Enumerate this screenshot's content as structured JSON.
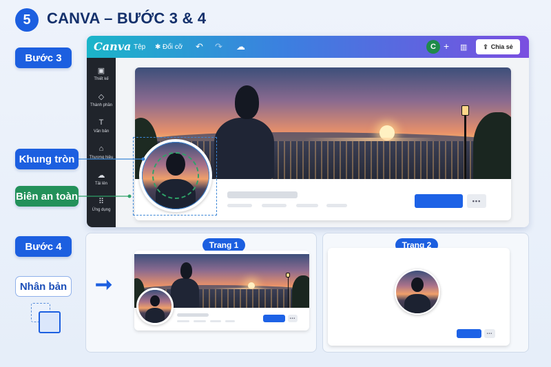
{
  "header": {
    "step_number": "5",
    "title": "CANVA – BƯỚC 3 & 4"
  },
  "labels": {
    "step3": "Bước 3",
    "step4": "Bước 4",
    "circle_frame": "Khung tròn",
    "safe_zone": "Biên an toàn",
    "duplicate": "Nhân bản"
  },
  "canva": {
    "logo": "Canva",
    "menu_file": "Tệp",
    "menu_resize": "Đổi cỡ",
    "avatar_initial": "C",
    "share_label": "Chia sẻ",
    "sidebar": [
      {
        "icon": "layout-icon",
        "label": "Thiết kế"
      },
      {
        "icon": "elements-icon",
        "label": "Thành phần"
      },
      {
        "icon": "text-icon",
        "label": "Văn bản"
      },
      {
        "icon": "brand-icon",
        "label": "Thương hiệu"
      },
      {
        "icon": "upload-icon",
        "label": "Tải lên"
      },
      {
        "icon": "apps-icon",
        "label": "Ứng dụng"
      }
    ],
    "more_label": "•••"
  },
  "pages": {
    "page1": "Trang 1",
    "page2": "Trang 2"
  },
  "colors": {
    "accent_blue": "#1c5fe0",
    "safe_green": "#23915a",
    "topbar_start": "#1bb5c9",
    "topbar_end": "#7a4fe0"
  }
}
